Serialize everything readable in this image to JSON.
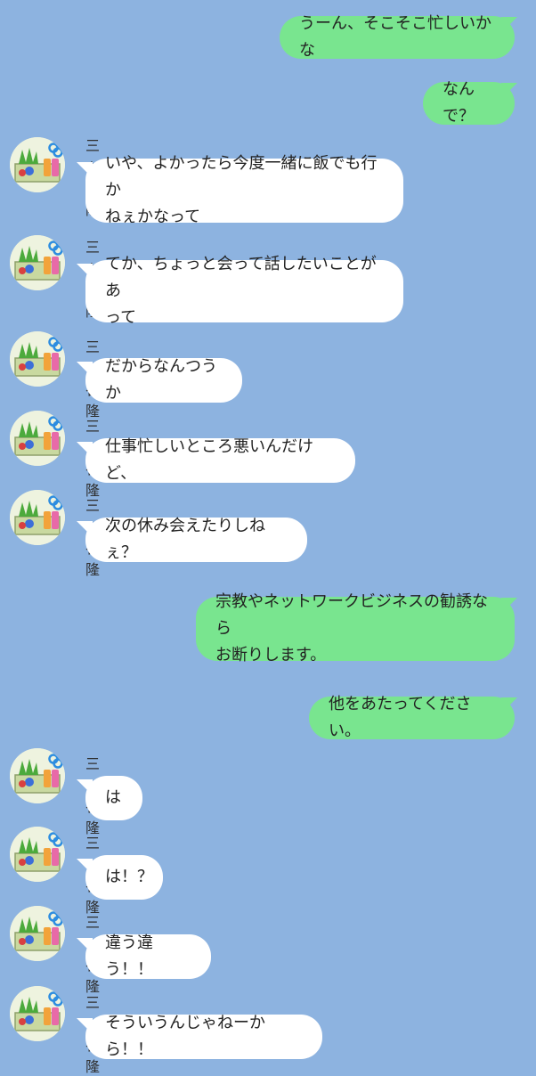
{
  "conversation": {
    "messages": [
      {
        "dir": "out",
        "text": "うーん、そこそこ忙しいかな"
      },
      {
        "dir": "out",
        "text": "なんで？"
      },
      {
        "dir": "in",
        "sender": "三ツ谷隆",
        "text": "いや、よかったら今度一緒に飯でも行か\nねぇかなって"
      },
      {
        "dir": "in",
        "sender": "三ツ谷隆",
        "text": "てか、ちょっと会って話したいことがあ\nって"
      },
      {
        "dir": "in",
        "sender": "三ツ谷隆",
        "text": "だからなんつうか"
      },
      {
        "dir": "in",
        "sender": "三ツ谷隆",
        "text": "仕事忙しいところ悪いんだけど、"
      },
      {
        "dir": "in",
        "sender": "三ツ谷隆",
        "text": "次の休み会えたりしねぇ？"
      },
      {
        "dir": "out",
        "text": "宗教やネットワークビジネスの勧誘なら\nお断りします。"
      },
      {
        "dir": "out",
        "text": "他をあたってください。"
      },
      {
        "dir": "in",
        "sender": "三ツ谷隆",
        "text": "は"
      },
      {
        "dir": "in",
        "sender": "三ツ谷隆",
        "text": "は！？"
      },
      {
        "dir": "in",
        "sender": "三ツ谷隆",
        "text": "違う違う！！"
      },
      {
        "dir": "in",
        "sender": "三ツ谷隆",
        "text": "そういうんじゃねーから！！"
      }
    ]
  },
  "colors": {
    "background": "#8db3e0",
    "outgoing_bubble": "#79e58f",
    "incoming_bubble": "#ffffff"
  },
  "icons": {
    "avatar": "sewing-kit-avatar-icon"
  }
}
